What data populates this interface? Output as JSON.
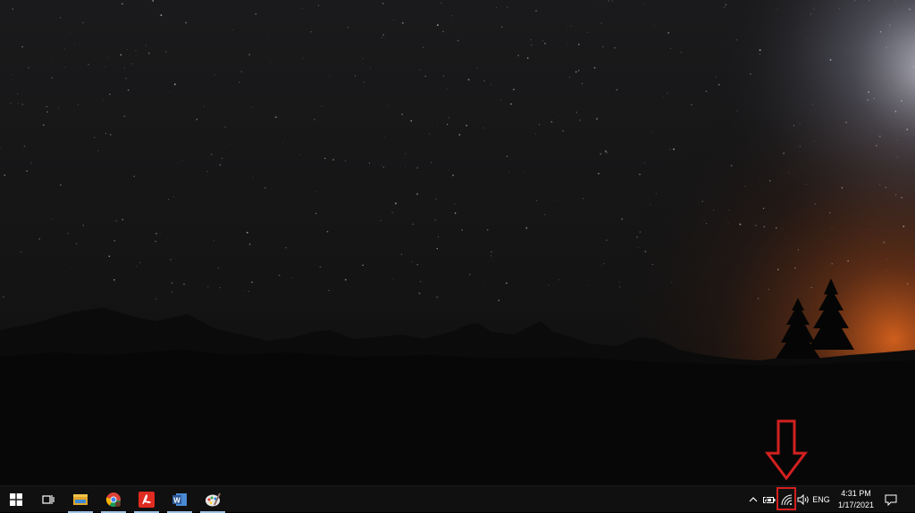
{
  "wallpaper": {
    "description_icon": "night-sky-mountains-wallpaper"
  },
  "taskbar": {
    "start_icon": "windows-logo-icon",
    "task_view_icon": "task-view-icon",
    "pinned": [
      {
        "id": "file-explorer",
        "icon": "file-explorer-icon"
      },
      {
        "id": "chrome",
        "icon": "chrome-icon"
      },
      {
        "id": "pdf-app",
        "icon": "pdf-icon"
      },
      {
        "id": "word",
        "icon": "word-icon",
        "label": "W"
      },
      {
        "id": "paint",
        "icon": "paint-icon"
      }
    ],
    "tray": {
      "chevron_icon": "chevron-up-icon",
      "battery_icon": "battery-icon",
      "wifi_icon": "wifi-icon",
      "volume_icon": "volume-icon",
      "language": "ENG",
      "time": "4:31 PM",
      "date": "1/17/2021",
      "notifications_icon": "action-center-icon"
    }
  },
  "annotation": {
    "arrow_color": "#d32020",
    "target": "wifi-icon"
  }
}
